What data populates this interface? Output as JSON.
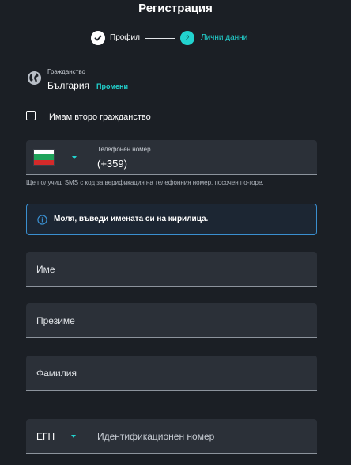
{
  "title": "Регистрация",
  "stepper": {
    "step1_label": "Профил",
    "step2_number": "2",
    "step2_label": "Лични данни"
  },
  "citizenship": {
    "caption": "Гражданство",
    "value": "България",
    "change_link": "Промени"
  },
  "second_citizenship": {
    "label": "Имам второ гражданство",
    "checked": false
  },
  "phone": {
    "country_flag": "bulgaria-flag",
    "label": "Телефонен номер",
    "value": "(+359)",
    "hint": "Ще получиш SMS с код за верификация на телефонния номер, посочен по-горе."
  },
  "info_message": "Моля, въведи имената си на кирилица.",
  "fields": {
    "first_name": "Име",
    "middle_name": "Презиме",
    "last_name": "Фамилия"
  },
  "id_document": {
    "type": "ЕГН",
    "placeholder": "Идентификационен номер"
  },
  "colors": {
    "background": "#1b1f25",
    "accent": "#22d3cf",
    "field": "#2b3038",
    "info_border": "#3a8fd0"
  }
}
